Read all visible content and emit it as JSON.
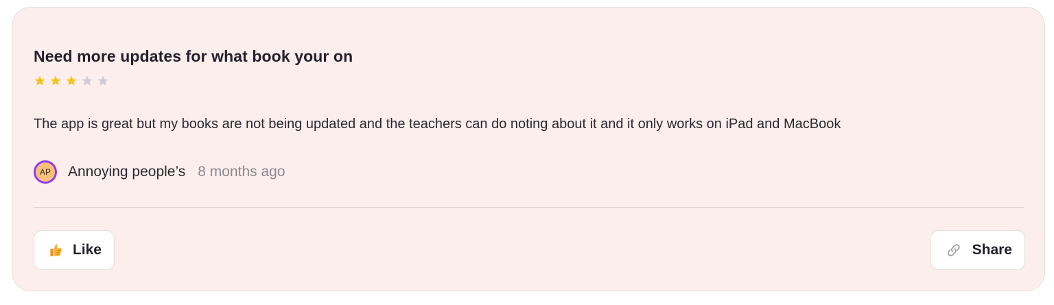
{
  "review": {
    "title": "Need more updates for what book your on",
    "rating": 3,
    "rating_max": 5,
    "body": "The app is great but my books are not being updated and the teachers can do noting about it and it only works on iPad and MacBook",
    "author": {
      "initials": "AP",
      "name": "Annoying people’s"
    },
    "time": "8 months ago"
  },
  "actions": {
    "like_label": "Like",
    "like_icon": "thumbs-up-icon",
    "share_label": "Share",
    "share_icon": "link-icon"
  },
  "colors": {
    "card_background": "#fbeeec",
    "star_filled": "#f5c518",
    "star_empty": "#cfcbd3",
    "avatar_ring": "#8f3df2",
    "avatar_fill": "#f7c17a"
  }
}
